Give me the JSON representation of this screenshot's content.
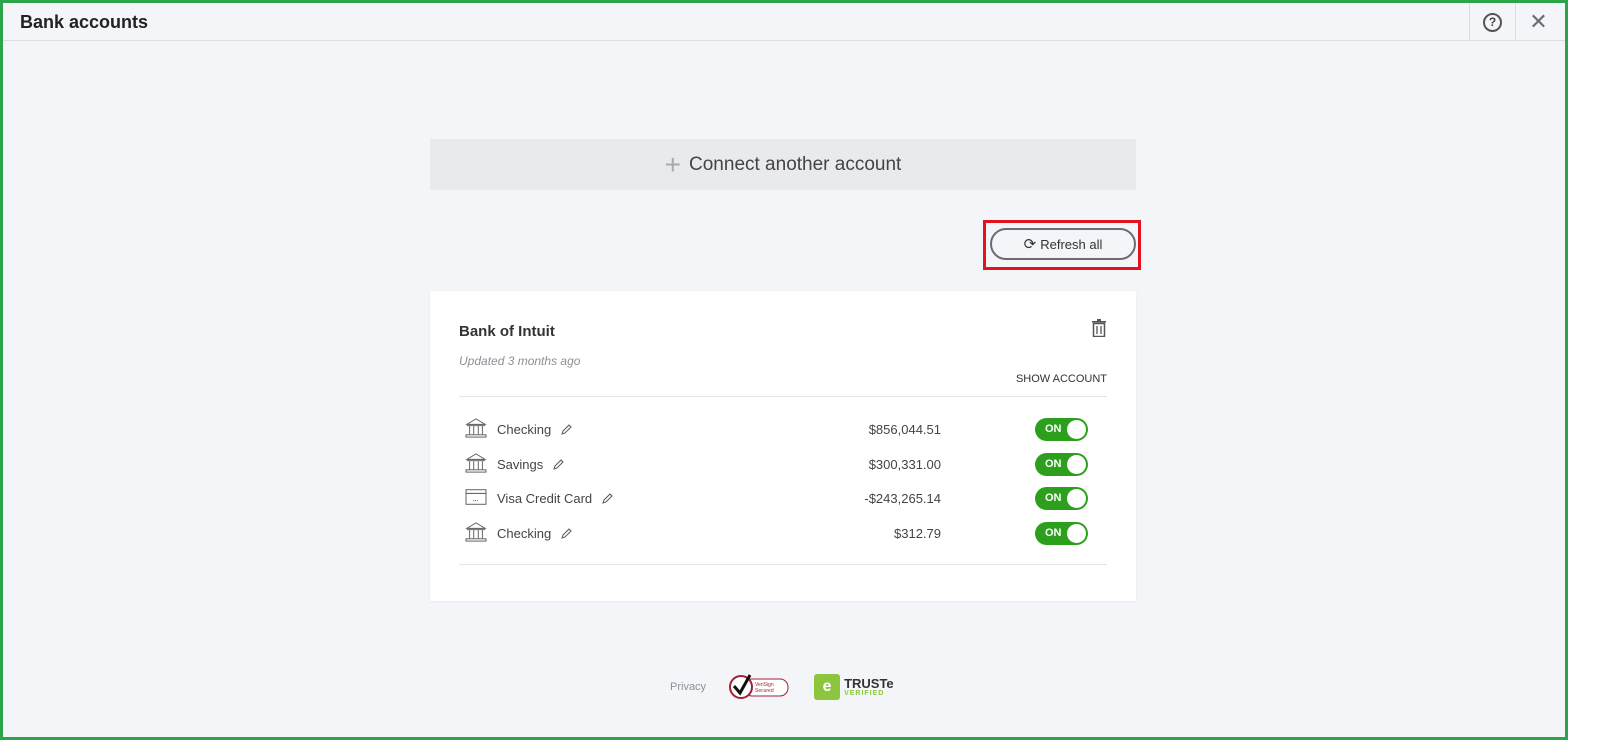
{
  "header": {
    "title": "Bank accounts",
    "help_icon": "question-circle-icon",
    "close_icon": "close-icon"
  },
  "connect": {
    "label": "Connect another account"
  },
  "refresh": {
    "label": "Refresh all"
  },
  "card": {
    "bank_name": "Bank of Intuit",
    "updated": "Updated 3 months ago",
    "show_account": "SHOW ACCOUNT",
    "accounts": [
      {
        "name": "Checking",
        "amount": "$856,044.51",
        "toggle": "ON",
        "icon": "bank-icon"
      },
      {
        "name": "Savings",
        "amount": "$300,331.00",
        "toggle": "ON",
        "icon": "bank-icon"
      },
      {
        "name": "Visa Credit Card",
        "amount": "-$243,265.14",
        "toggle": "ON",
        "icon": "credit-card-icon"
      },
      {
        "name": "Checking",
        "amount": "$312.79",
        "toggle": "ON",
        "icon": "bank-icon"
      }
    ]
  },
  "footer": {
    "privacy": "Privacy",
    "verisign": "VeriSign Secured",
    "truste": "TRUSTe",
    "truste_sub": "VERIFIED"
  },
  "colors": {
    "toggle_on": "#2ca01c",
    "highlight": "#e3121e",
    "frame": "#2ca54a"
  }
}
